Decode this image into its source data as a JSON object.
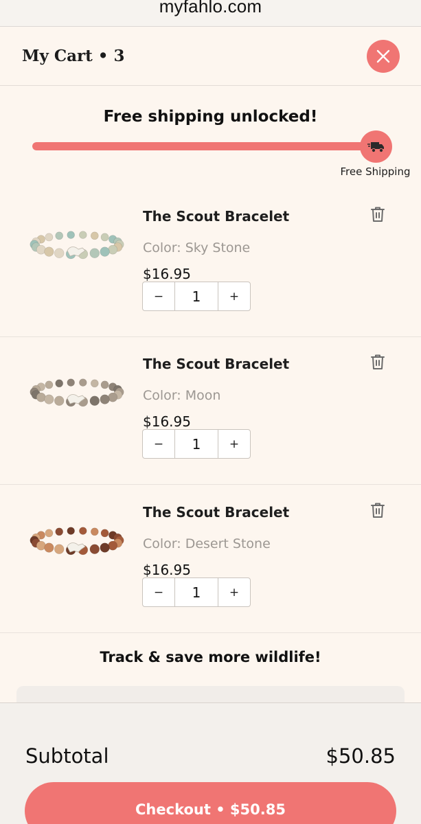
{
  "browser": {
    "url": "myfahlo.com"
  },
  "cart": {
    "title": "My Cart • 3"
  },
  "shipping": {
    "message": "Free shipping unlocked!",
    "progress": 1.0,
    "label": "Free Shipping"
  },
  "items": [
    {
      "name": "The Scout Bracelet",
      "color": "Color: Sky Stone",
      "price": "$16.95",
      "qty": "1",
      "minus": "−",
      "plus": "+"
    },
    {
      "name": "The Scout Bracelet",
      "color": "Color: Moon",
      "price": "$16.95",
      "qty": "1",
      "minus": "−",
      "plus": "+"
    },
    {
      "name": "The Scout Bracelet",
      "color": "Color: Desert Stone",
      "price": "$16.95",
      "qty": "1",
      "minus": "−",
      "plus": "+"
    }
  ],
  "upsell": {
    "title": "Track & save more wildlife!"
  },
  "footer": {
    "subtotal_label": "Subtotal",
    "subtotal_value": "$50.85",
    "checkout_label": "Checkout • $50.85"
  },
  "colors": {
    "accent": "#f07573",
    "background": "#fdf6ef",
    "footer": "#f3f0ec",
    "bead_sky": [
      "#c9cdb6",
      "#9fc2b9",
      "#d7c7a8",
      "#b3c7b8",
      "#e0d6c4"
    ],
    "bead_moon": [
      "#a99c8d",
      "#8e8377",
      "#c4b6a4",
      "#7d746a",
      "#b9ab99"
    ],
    "bead_desert": [
      "#a35a3a",
      "#6e3b28",
      "#c9895f",
      "#8a4b33",
      "#d6a67d"
    ]
  }
}
